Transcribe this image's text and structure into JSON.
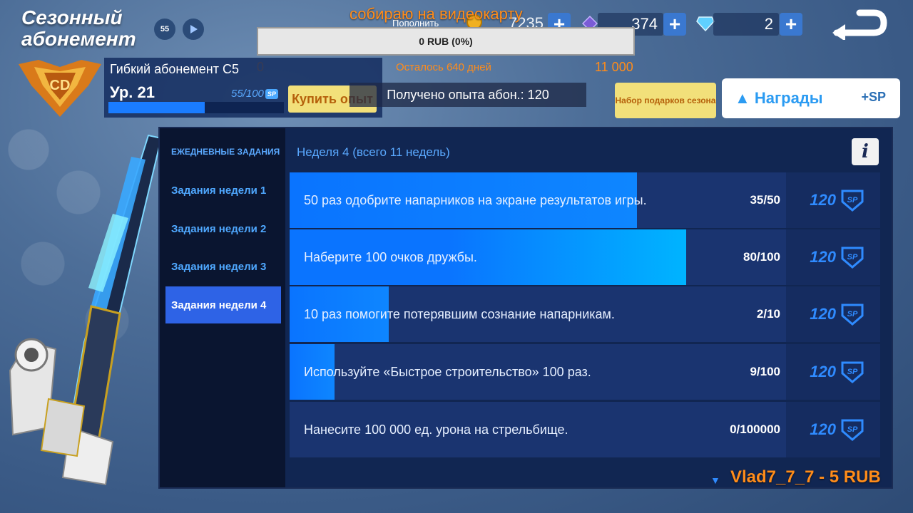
{
  "header": {
    "title": "Сезонный абонемент",
    "season_icon": "55",
    "play_icon": "play-icon"
  },
  "stream": {
    "title": "собираю на видеокарту",
    "topup_label": "Пополнить",
    "donation_progress": "0 RUB (0%)",
    "donation_progress_fraction": 0,
    "days_left": "Осталось 640 дней",
    "goal": "11 000",
    "current": "0",
    "donor_line": "Vlad7_7_7 - 5 RUB"
  },
  "currencies": [
    {
      "icon": "gold-coin-icon",
      "value": "7235"
    },
    {
      "icon": "purple-gem-icon",
      "value": "374"
    },
    {
      "icon": "diamond-icon",
      "value": "2"
    }
  ],
  "pass": {
    "name": "Гибкий абонемент С5",
    "level": "Ур. 21",
    "exp": "55/100",
    "exp_fraction": 0.55,
    "sp_label": "SP",
    "buy_exp": "Купить опыт",
    "exp_received": "Получено опыта абон.: 120"
  },
  "buttons": {
    "gift_set": "Набор подарков сезона",
    "rewards": "▲ Награды",
    "rewards_sp": "+SP"
  },
  "nav": {
    "items": [
      {
        "label": "ЕЖЕДНЕВНЫЕ ЗАДАНИЯ"
      },
      {
        "label": "Задания недели 1"
      },
      {
        "label": "Задания недели 2"
      },
      {
        "label": "Задания недели 3"
      },
      {
        "label": "Задания недели 4"
      }
    ],
    "active_index": 4
  },
  "quests": {
    "week_header": "Неделя 4 (всего 11 недель)",
    "info_label": "i",
    "items": [
      {
        "text": "50 раз одобрите напарников на экране результатов игры.",
        "progress": "35/50",
        "fraction": 0.7,
        "reward": "120"
      },
      {
        "text": "Наберите 100 очков дружбы.",
        "progress": "80/100",
        "fraction": 0.8,
        "reward": "120"
      },
      {
        "text": "10 раз помогите потерявшим сознание напарникам.",
        "progress": "2/10",
        "fraction": 0.2,
        "reward": "120"
      },
      {
        "text": "Используйте «Быстрое строительство» 100 раз.",
        "progress": "9/100",
        "fraction": 0.09,
        "reward": "120"
      },
      {
        "text": "Нанесите 100 000 ед. урона на стрельбище.",
        "progress": "0/100000",
        "fraction": 0,
        "reward": "120"
      }
    ],
    "scroll_indicator": "▼"
  },
  "colors": {
    "accent_blue": "#1a7cff",
    "nav_active": "#2e63e6",
    "orange_text": "#ff8c1a",
    "gold_button": "#f2e07a"
  }
}
